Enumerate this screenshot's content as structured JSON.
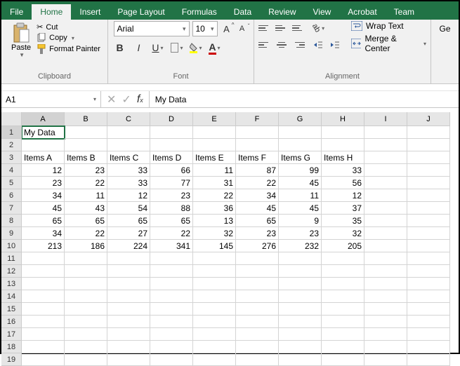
{
  "tabs": [
    "File",
    "Home",
    "Insert",
    "Page Layout",
    "Formulas",
    "Data",
    "Review",
    "View",
    "Acrobat",
    "Team"
  ],
  "activeTab": 1,
  "clipboard": {
    "cut": "Cut",
    "copy": "Copy",
    "fmt": "Format Painter",
    "paste": "Paste",
    "group": "Clipboard"
  },
  "font": {
    "name": "Arial",
    "size": "10",
    "group": "Font"
  },
  "alignment": {
    "wrap": "Wrap Text",
    "merge": "Merge & Center",
    "group": "Alignment",
    "ge": "Ge"
  },
  "namebox": "A1",
  "formula": "My Data",
  "columns": [
    "A",
    "B",
    "C",
    "D",
    "E",
    "F",
    "G",
    "H",
    "I",
    "J"
  ],
  "rowCount": 19,
  "sheet": {
    "A1": "My Data",
    "headersRow": 3,
    "headers": [
      "Items A",
      "Items B",
      "Items C",
      "Items D",
      "Items E",
      "Items F",
      "Items G",
      "Items H"
    ],
    "data": [
      [
        12,
        23,
        33,
        66,
        11,
        87,
        99,
        33
      ],
      [
        23,
        22,
        33,
        77,
        31,
        22,
        45,
        56
      ],
      [
        34,
        11,
        12,
        23,
        22,
        34,
        11,
        12
      ],
      [
        45,
        43,
        54,
        88,
        36,
        45,
        45,
        37
      ],
      [
        65,
        65,
        65,
        65,
        13,
        65,
        9,
        35
      ],
      [
        34,
        22,
        27,
        22,
        32,
        23,
        23,
        32
      ],
      [
        213,
        186,
        224,
        341,
        145,
        276,
        232,
        205
      ]
    ]
  },
  "selected": {
    "col": 0,
    "row": 1
  }
}
